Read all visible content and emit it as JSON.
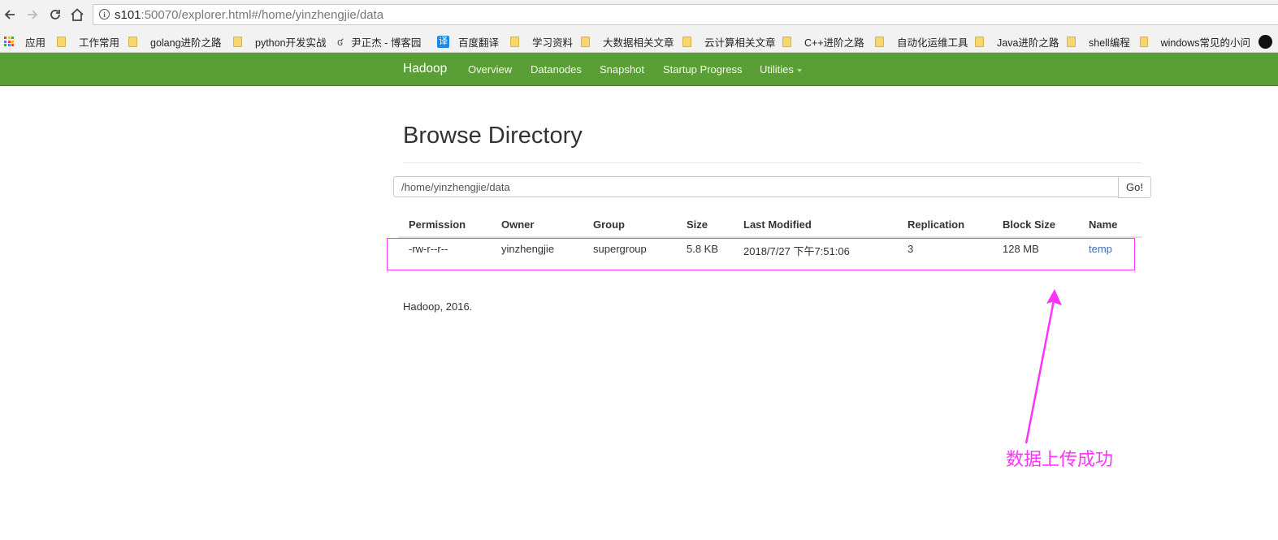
{
  "browser": {
    "url_host": "s101",
    "url_rest": ":50070/explorer.html#/home/yinzhengjie/data"
  },
  "bookmarks": [
    {
      "label": "应用"
    },
    {
      "label": "工作常用"
    },
    {
      "label": "golang进阶之路"
    },
    {
      "label": "python开发实战"
    },
    {
      "label": "尹正杰 - 博客园"
    },
    {
      "label": "百度翻译"
    },
    {
      "label": "学习资料"
    },
    {
      "label": "大数据相关文章"
    },
    {
      "label": "云计算相关文章"
    },
    {
      "label": "C++进阶之路"
    },
    {
      "label": "自动化运维工具"
    },
    {
      "label": "Java进阶之路"
    },
    {
      "label": "shell编程"
    },
    {
      "label": "windows常见的小问"
    }
  ],
  "navbar": {
    "brand": "Hadoop",
    "items": [
      "Overview",
      "Datanodes",
      "Snapshot",
      "Startup Progress",
      "Utilities"
    ]
  },
  "page": {
    "title": "Browse Directory",
    "path_value": "/home/yinzhengjie/data",
    "go_label": "Go!"
  },
  "table": {
    "headers": [
      "Permission",
      "Owner",
      "Group",
      "Size",
      "Last Modified",
      "Replication",
      "Block Size",
      "Name"
    ],
    "rows": [
      [
        "-rw-r--r--",
        "yinzhengjie",
        "supergroup",
        "5.8 KB",
        "2018/7/27 下午7:51:06",
        "3",
        "128 MB",
        "temp"
      ]
    ]
  },
  "footer": "Hadoop, 2016.",
  "annotation": "数据上传成功",
  "colors": {
    "navbar": "#5a9f35",
    "highlight": "#ff33ff",
    "link": "#3d6db2"
  }
}
